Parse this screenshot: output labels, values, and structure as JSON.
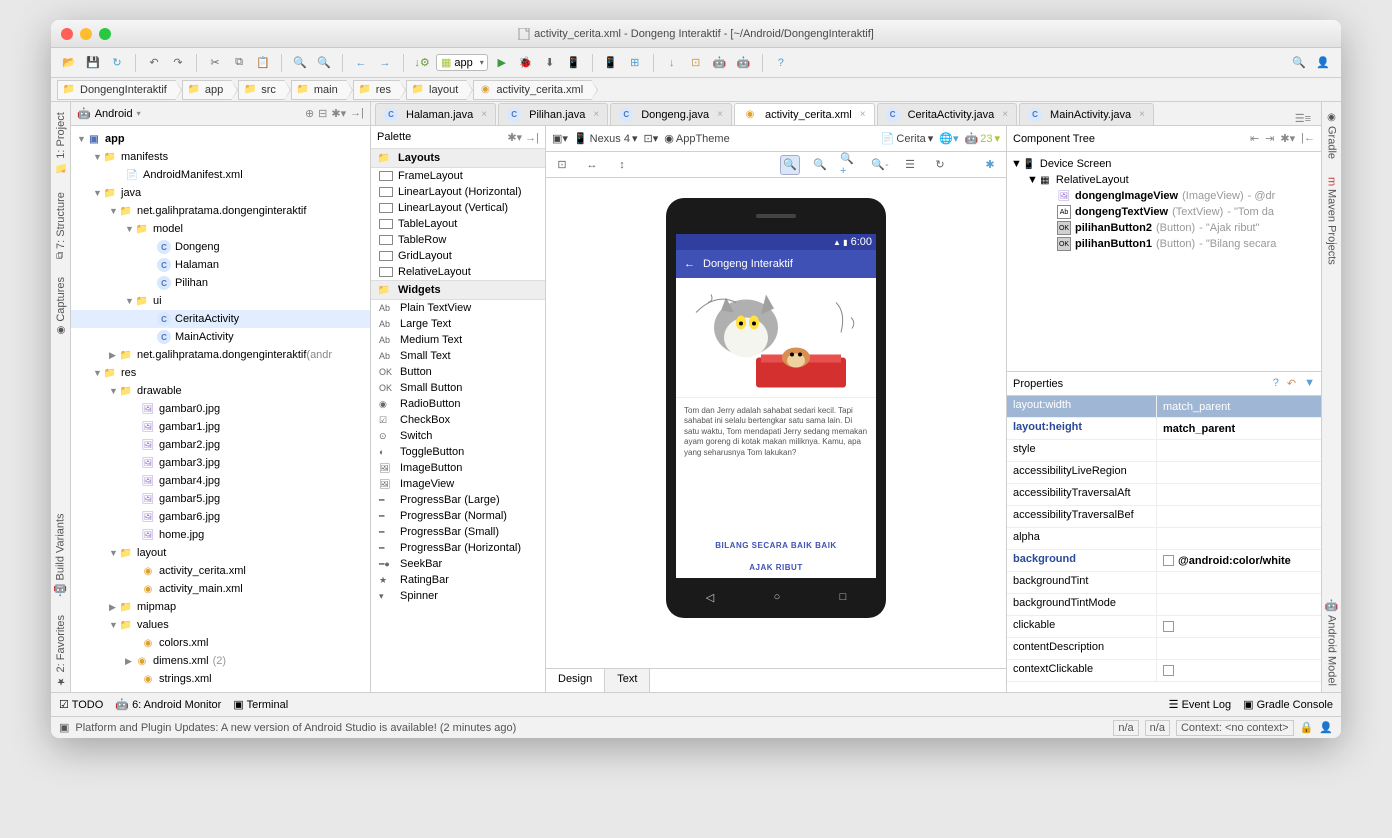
{
  "window": {
    "title": "activity_cerita.xml - Dongeng Interaktif - [~/Android/DongengInteraktif]"
  },
  "toolbar": {
    "app_label": "app"
  },
  "breadcrumb": [
    "DongengInteraktif",
    "app",
    "src",
    "main",
    "res",
    "layout",
    "activity_cerita.xml"
  ],
  "project": {
    "view_mode": "Android",
    "tree": {
      "app": "app",
      "manifests": "manifests",
      "manifest": "AndroidManifest.xml",
      "java": "java",
      "pkg": "net.galihpratama.dongenginteraktif",
      "model": "model",
      "mDongeng": "Dongeng",
      "mHalaman": "Halaman",
      "mPilihan": "Pilihan",
      "ui": "ui",
      "cerita": "CeritaActivity",
      "main": "MainActivity",
      "pkg_test": "net.galihpratama.dongenginteraktif",
      "pkg_test_extra": "(andr",
      "res": "res",
      "drawable": "drawable",
      "g0": "gambar0.jpg",
      "g1": "gambar1.jpg",
      "g2": "gambar2.jpg",
      "g3": "gambar3.jpg",
      "g4": "gambar4.jpg",
      "g5": "gambar5.jpg",
      "g6": "gambar6.jpg",
      "home": "home.jpg",
      "layout": "layout",
      "lcerita": "activity_cerita.xml",
      "lmain": "activity_main.xml",
      "mipmap": "mipmap",
      "values": "values",
      "colors": "colors.xml",
      "dimens": "dimens.xml",
      "dimens_count": "(2)",
      "strings": "strings.xml"
    }
  },
  "tabs": [
    {
      "label": "Halaman.java",
      "icon": "class"
    },
    {
      "label": "Pilihan.java",
      "icon": "class"
    },
    {
      "label": "Dongeng.java",
      "icon": "class"
    },
    {
      "label": "activity_cerita.xml",
      "icon": "xml",
      "active": true
    },
    {
      "label": "CeritaActivity.java",
      "icon": "class"
    },
    {
      "label": "MainActivity.java",
      "icon": "class"
    }
  ],
  "palette": {
    "title": "Palette",
    "sections": {
      "layouts": "Layouts",
      "layouts_items": [
        "FrameLayout",
        "LinearLayout (Horizontal)",
        "LinearLayout (Vertical)",
        "TableLayout",
        "TableRow",
        "GridLayout",
        "RelativeLayout"
      ],
      "widgets": "Widgets",
      "widgets_items": [
        "Plain TextView",
        "Large Text",
        "Medium Text",
        "Small Text",
        "Button",
        "Small Button",
        "RadioButton",
        "CheckBox",
        "Switch",
        "ToggleButton",
        "ImageButton",
        "ImageView",
        "ProgressBar (Large)",
        "ProgressBar (Normal)",
        "ProgressBar (Small)",
        "ProgressBar (Horizontal)",
        "SeekBar",
        "RatingBar",
        "Spinner"
      ]
    }
  },
  "design_toolbar": {
    "device": "Nexus 4",
    "theme": "AppTheme",
    "activity": "Cerita",
    "api": "23"
  },
  "phone": {
    "time": "6:00",
    "app_title": "Dongeng Interaktif",
    "body": "Tom dan Jerry adalah sahabat sedari kecil. Tapi sahabat ini selalu bertengkar satu sama lain. Di satu waktu, Tom mendapati Jerry sedang memakan ayam goreng di kotak makan miliknya. Kamu, apa yang seharusnya Tom lakukan?",
    "btn1": "BILANG SECARA BAIK BAIK",
    "btn2": "AJAK RIBUT"
  },
  "design_tabs": {
    "design": "Design",
    "text": "Text"
  },
  "component_tree": {
    "title": "Component Tree",
    "root": "Device Screen",
    "rl": "RelativeLayout",
    "iv": "dongengImageView",
    "iv_t": "(ImageView)",
    "iv_e": "- @dr",
    "tv": "dongengTextView",
    "tv_t": "(TextView)",
    "tv_e": "- \"Tom da",
    "b2": "pilihanButton2",
    "b2_t": "(Button)",
    "b2_e": "- \"Ajak ribut\"",
    "b1": "pilihanButton1",
    "b1_t": "(Button)",
    "b1_e": "- \"Bilang secara"
  },
  "properties": {
    "title": "Properties",
    "rows": [
      {
        "name": "layout:width",
        "val": "match_parent",
        "hdr": true
      },
      {
        "name": "layout:height",
        "val": "match_parent",
        "bold": true
      },
      {
        "name": "style",
        "val": ""
      },
      {
        "name": "accessibilityLiveRegion",
        "val": ""
      },
      {
        "name": "accessibilityTraversalAft",
        "val": ""
      },
      {
        "name": "accessibilityTraversalBef",
        "val": ""
      },
      {
        "name": "alpha",
        "val": ""
      },
      {
        "name": "background",
        "val": "@android:color/white",
        "bold": true,
        "chk": true
      },
      {
        "name": "backgroundTint",
        "val": ""
      },
      {
        "name": "backgroundTintMode",
        "val": ""
      },
      {
        "name": "clickable",
        "val": "",
        "chk": true
      },
      {
        "name": "contentDescription",
        "val": ""
      },
      {
        "name": "contextClickable",
        "val": "",
        "chk": true
      }
    ]
  },
  "bottom": {
    "todo": "TODO",
    "monitor": "6: Android Monitor",
    "terminal": "Terminal",
    "eventlog": "Event Log",
    "gradle": "Gradle Console",
    "msg": "Platform and Plugin Updates: A new version of Android Studio is available! (2 minutes ago)",
    "na": "n/a",
    "context": "Context: <no context>"
  },
  "sidebar_left": [
    "1: Project",
    "7: Structure",
    "Captures",
    "Build Variants",
    "2: Favorites"
  ],
  "sidebar_right": [
    "Gradle",
    "Maven Projects",
    "Android Model"
  ]
}
